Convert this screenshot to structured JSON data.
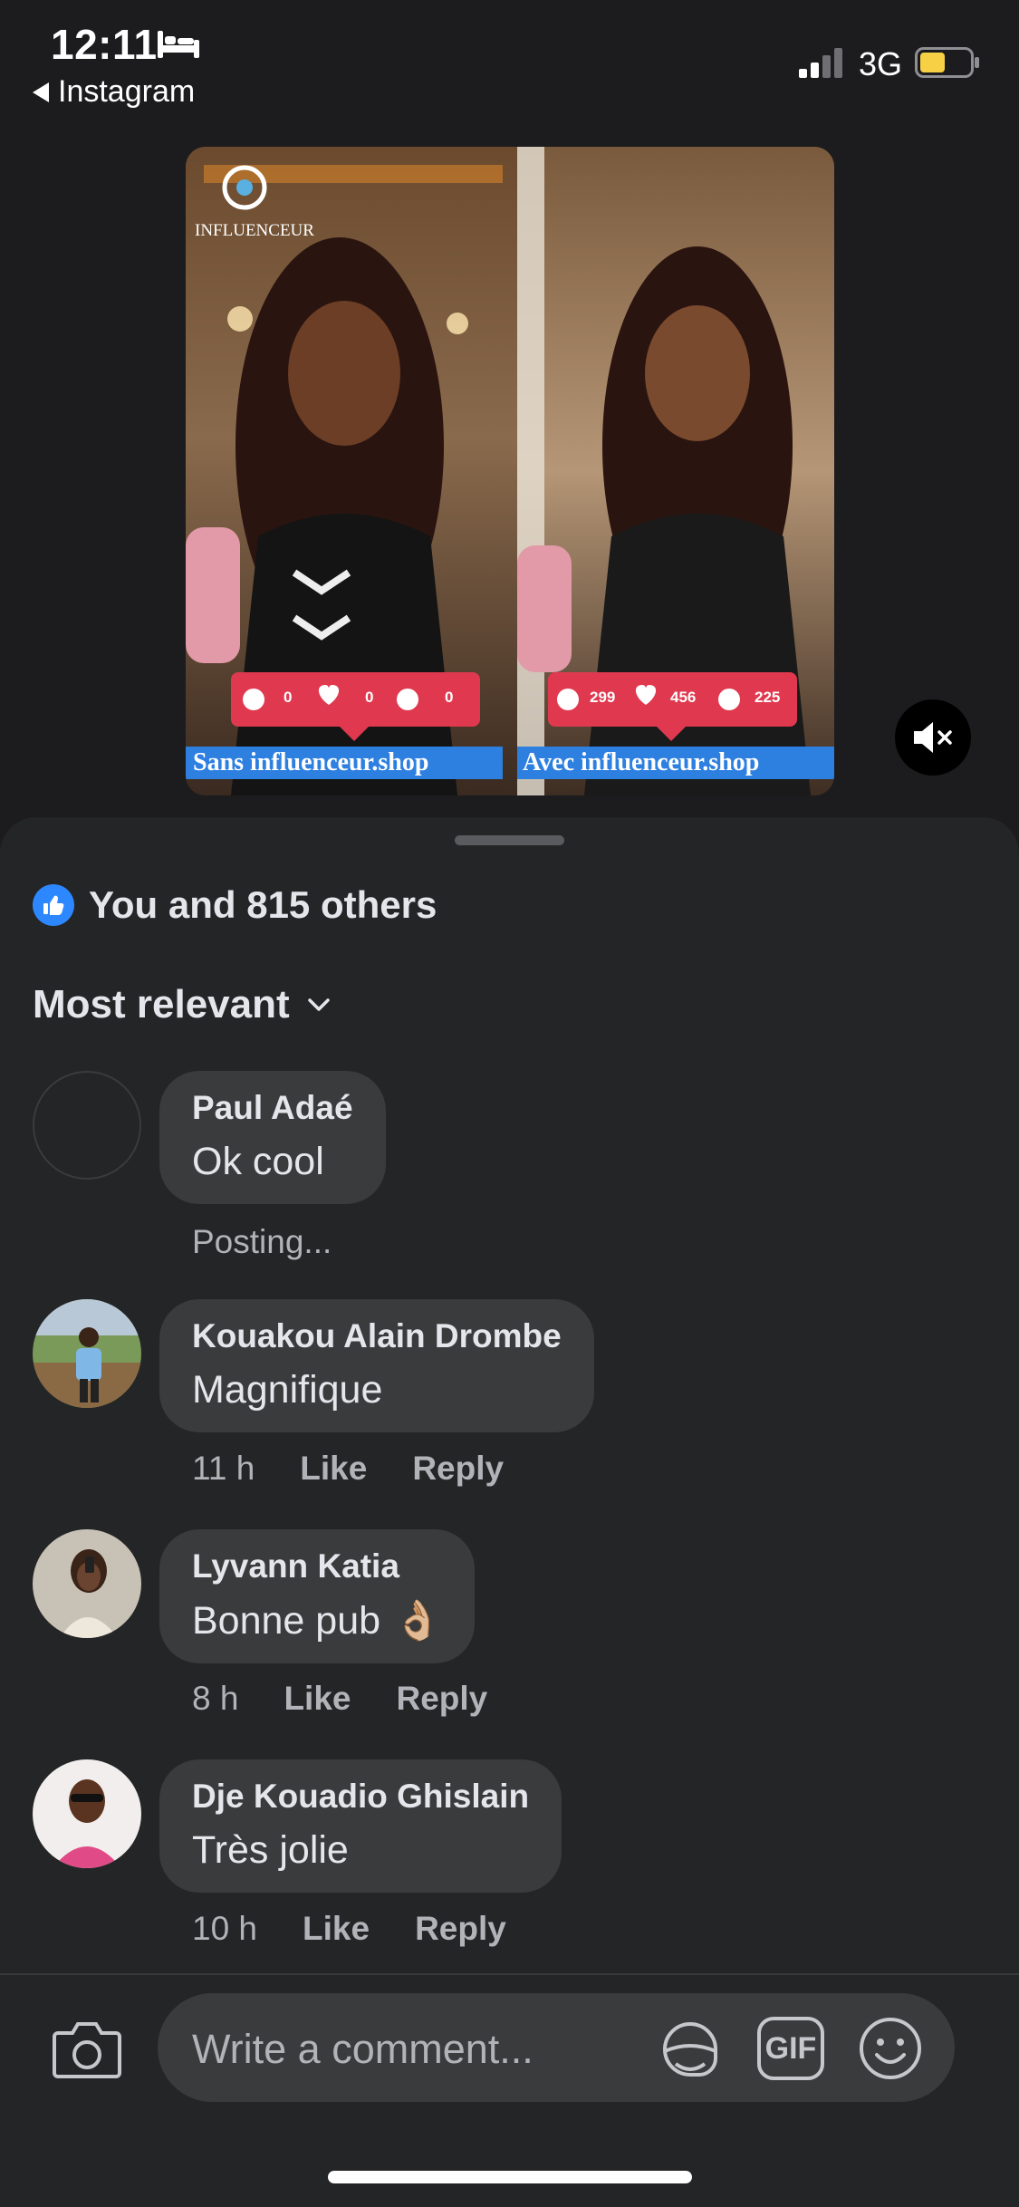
{
  "status_bar": {
    "time": "12:11",
    "back_app": "Instagram",
    "network": "3G",
    "battery_level": 0.5,
    "battery_color": "#f7d046",
    "icons": [
      "bed-icon",
      "signal-icon",
      "battery-icon"
    ]
  },
  "media": {
    "brand": "INFLUENCEUR",
    "left_panel": {
      "caption": "Sans influenceur.shop",
      "counts": [
        "0",
        "0",
        "0"
      ]
    },
    "right_panel": {
      "caption": "Avec influenceur.shop",
      "counts": [
        "299",
        "456",
        "225"
      ]
    },
    "mute_icon": "speaker-muted-icon"
  },
  "reactions": {
    "icon": "thumbs-up-icon",
    "text": "You and 815 others",
    "color": "#2d88ff"
  },
  "sort": {
    "label": "Most relevant",
    "icon": "chevron-down-icon"
  },
  "comments": [
    {
      "author": "Paul Adaé",
      "text": "Ok cool",
      "status": "Posting..."
    },
    {
      "author": "Kouakou Alain Drombe",
      "text": "Magnifique",
      "time": "11 h",
      "like": "Like",
      "reply": "Reply"
    },
    {
      "author": "Lyvann Katia",
      "text": "Bonne pub",
      "emoji": "👌🏼",
      "time": "8 h",
      "like": "Like",
      "reply": "Reply"
    },
    {
      "author": "Dje Kouadio Ghislain",
      "text": "Très jolie",
      "time": "10 h",
      "like": "Like",
      "reply": "Reply"
    }
  ],
  "composer": {
    "placeholder": "Write a comment...",
    "gif_label": "GIF",
    "icons": [
      "camera-icon",
      "sticker-icon",
      "gif-icon",
      "emoji-icon"
    ]
  }
}
